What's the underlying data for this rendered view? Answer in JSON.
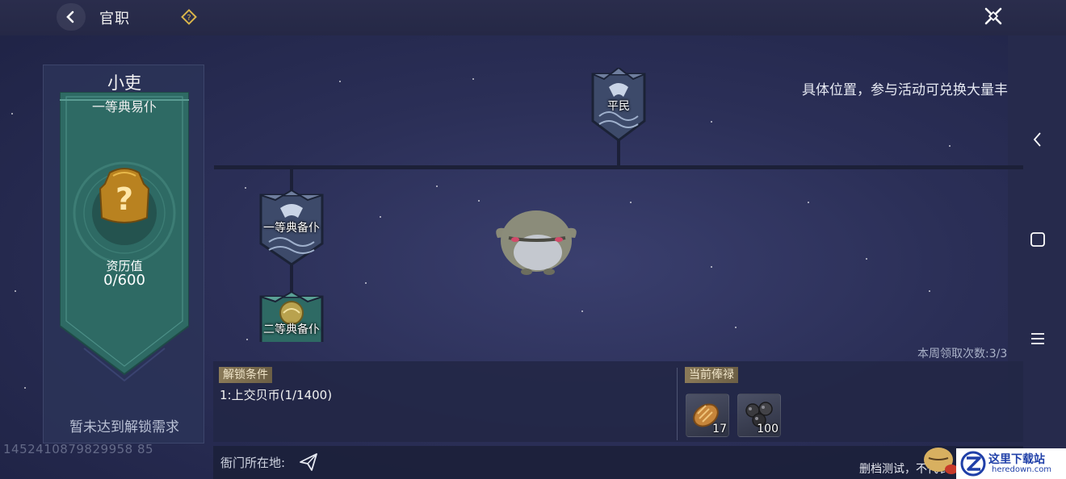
{
  "header": {
    "title": "官职"
  },
  "current_rank": {
    "name": "小吏",
    "subtitle": "一等典易仆",
    "qualification_label": "资历值",
    "qualification_value": "0/600",
    "status_message": "暂未达到解锁需求"
  },
  "user_id": "1452410879829958 85",
  "rank_tree": {
    "nodes": [
      {
        "label": "平民",
        "state": "locked"
      },
      {
        "label": "一等典备仆",
        "state": "locked"
      },
      {
        "label": "二等典备仆",
        "state": "current"
      }
    ]
  },
  "scroll_notice": "具体位置，参与活动可兑换大量丰厚奖励",
  "weekly_claims": "本周领取次数:3/3",
  "unlock": {
    "tag": "解锁条件",
    "condition": "1:上交贝币(1/1400)"
  },
  "salary": {
    "tag": "当前俸禄",
    "items": [
      {
        "icon": "bread-icon",
        "count": "17"
      },
      {
        "icon": "iron-balls-icon",
        "count": "100"
      }
    ]
  },
  "office_location_label": "衙门所在地:",
  "test_note": "删档测试，不代表",
  "watermark": {
    "name": "这里下载站",
    "url": "heredown.com"
  },
  "colors": {
    "background": "#2b2f57",
    "banner_teal": "#2e6a64",
    "tag_gold": "#8a7a58"
  }
}
